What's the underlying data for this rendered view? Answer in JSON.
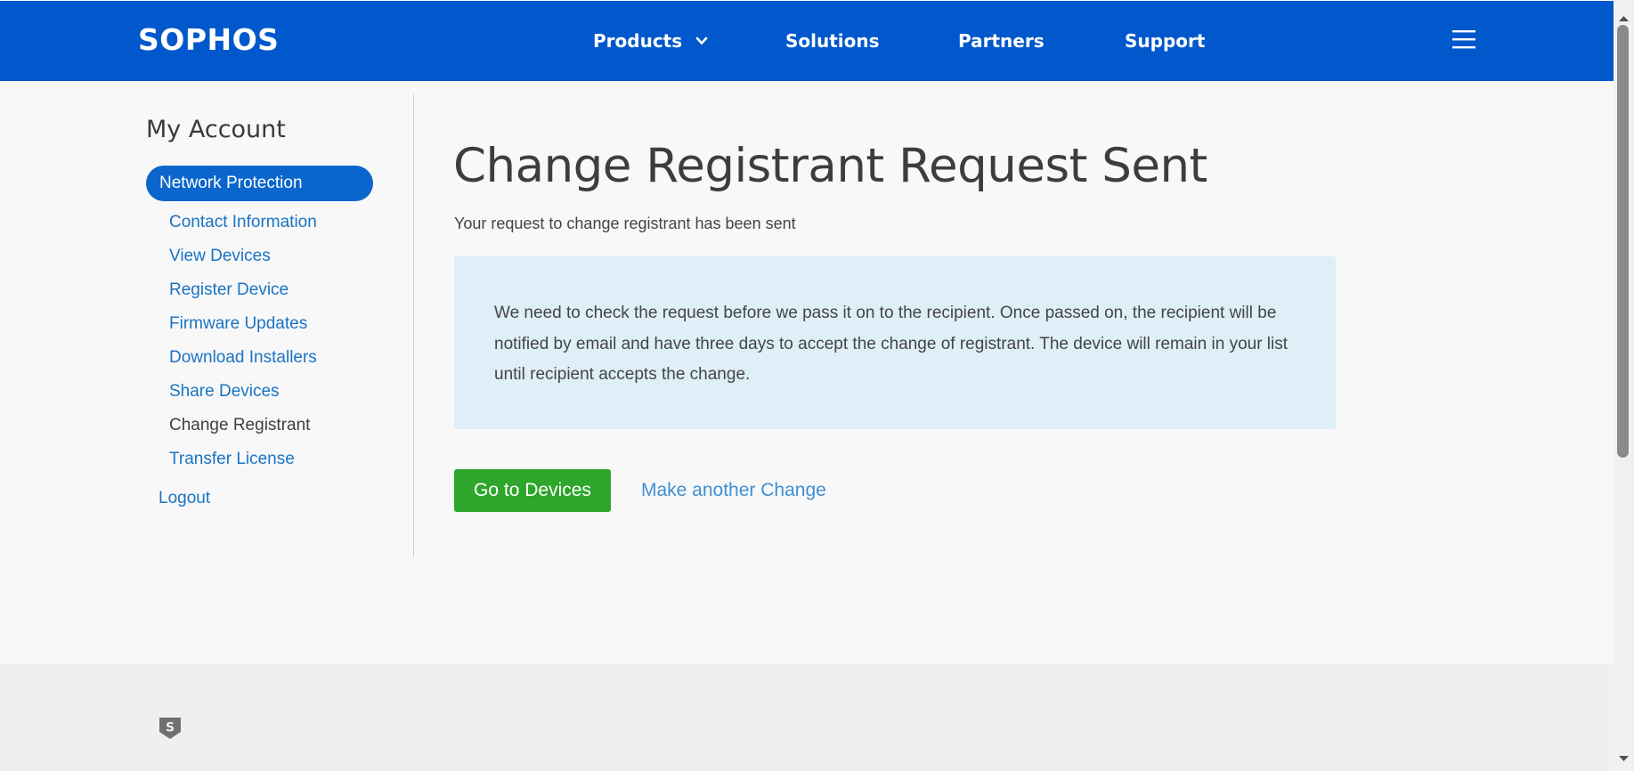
{
  "header": {
    "logo": "SOPHOS",
    "nav": {
      "products": "Products",
      "solutions": "Solutions",
      "partners": "Partners",
      "support": "Support"
    },
    "icons": {
      "dropdown": "chevron-down-icon",
      "menu": "hamburger-menu-icon"
    },
    "brand_color": "#0058cc"
  },
  "sidebar": {
    "title": "My Account",
    "active_section": "Network Protection",
    "items": [
      {
        "label": "Contact Information"
      },
      {
        "label": "View Devices"
      },
      {
        "label": "Register Device"
      },
      {
        "label": "Firmware Updates"
      },
      {
        "label": "Download Installers"
      },
      {
        "label": "Share Devices"
      },
      {
        "label": "Change Registrant",
        "current": true
      },
      {
        "label": "Transfer License"
      }
    ],
    "logout": "Logout"
  },
  "main": {
    "title": "Change Registrant Request Sent",
    "subtitle": "Your request to change registrant has been sent",
    "info_text": "We need to check the request before we pass it on to the recipient. Once passed on, the recipient will be notified by email and have three days to accept the change of registrant. The device will remain in your list until recipient accepts the change.",
    "primary_button": "Go to Devices",
    "secondary_link": "Make another Change",
    "colors": {
      "primary_button": "#2ea52b",
      "info_background": "#dfeff8",
      "link": "#3f8fd4"
    }
  },
  "footer": {
    "icon": "sophos-shield-icon"
  }
}
